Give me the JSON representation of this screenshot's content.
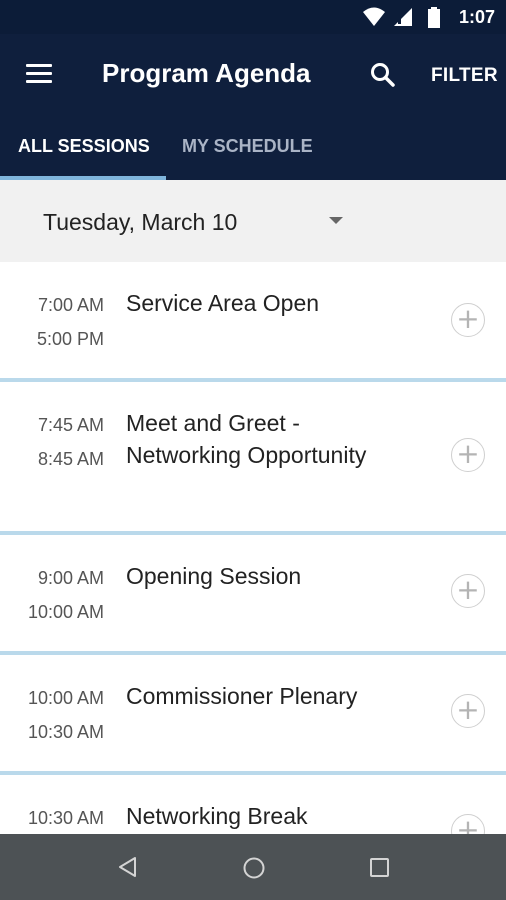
{
  "status_bar": {
    "time": "1:07",
    "icons": [
      "wifi-icon",
      "signal-icon",
      "battery-icon"
    ]
  },
  "app_bar": {
    "title": "Program Agenda",
    "filter_label": "FILTER",
    "menu_icon": "menu-icon",
    "search_icon": "search-icon"
  },
  "tabs": [
    {
      "label": "ALL SESSIONS",
      "active": true
    },
    {
      "label": "MY SCHEDULE",
      "active": false
    }
  ],
  "date_selector": {
    "value": "Tuesday, March 10"
  },
  "sessions": [
    {
      "start": "7:00 AM",
      "end": "5:00 PM",
      "title": "Service Area Open"
    },
    {
      "start": "7:45 AM",
      "end": "8:45 AM",
      "title": "Meet and Greet - Networking Opportunity"
    },
    {
      "start": "9:00 AM",
      "end": "10:00 AM",
      "title": "Opening Session"
    },
    {
      "start": "10:00 AM",
      "end": "10:30 AM",
      "title": "Commissioner Plenary"
    },
    {
      "start": "10:30 AM",
      "end": "",
      "title": "Networking Break"
    }
  ],
  "nav_bar": {
    "icons": [
      "back-icon",
      "home-icon",
      "recents-icon"
    ]
  },
  "colors": {
    "app_bar": "#0f1f3d",
    "status_bar": "#0c1c38",
    "tab_indicator": "#7fb5dc",
    "separator": "#bad9eb",
    "nav_bar": "#4d5255"
  }
}
